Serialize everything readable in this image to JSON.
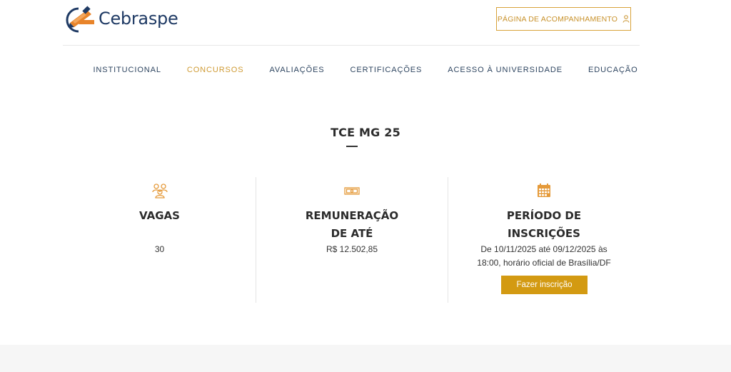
{
  "header": {
    "logo_text": "Cebraspe",
    "track_button_label": "PÁGINA DE ACOMPANHAMENTO"
  },
  "nav": {
    "items": [
      {
        "label": "INSTITUCIONAL",
        "active": false
      },
      {
        "label": "CONCURSOS",
        "active": true
      },
      {
        "label": "AVALIAÇÕES",
        "active": false
      },
      {
        "label": "CERTIFICAÇÕES",
        "active": false
      },
      {
        "label": "ACESSO À UNIVERSIDADE",
        "active": false
      },
      {
        "label": "EDUCAÇÃO",
        "active": false
      }
    ]
  },
  "page": {
    "title": "TCE MG 25"
  },
  "info": {
    "vagas": {
      "heading": "VAGAS",
      "value": "30",
      "icon": "users-icon"
    },
    "remuneracao": {
      "heading_line1": "REMUNERAÇÃO",
      "heading_line2": "DE ATÉ",
      "value": "R$ 12.502,85",
      "icon": "money-icon"
    },
    "periodo": {
      "heading_line1": "PERÍODO DE",
      "heading_line2": "INSCRIÇÕES",
      "value_line1": "De 10/11/2025 até 09/12/2025 às",
      "value_line2": "18:00, horário oficial de Brasília/DF",
      "icon": "calendar-icon",
      "button_label": "Fazer inscrição"
    }
  },
  "colors": {
    "accent": "#d39a12",
    "brand_blue": "#1f3a64",
    "brand_orange": "#e8842a"
  }
}
